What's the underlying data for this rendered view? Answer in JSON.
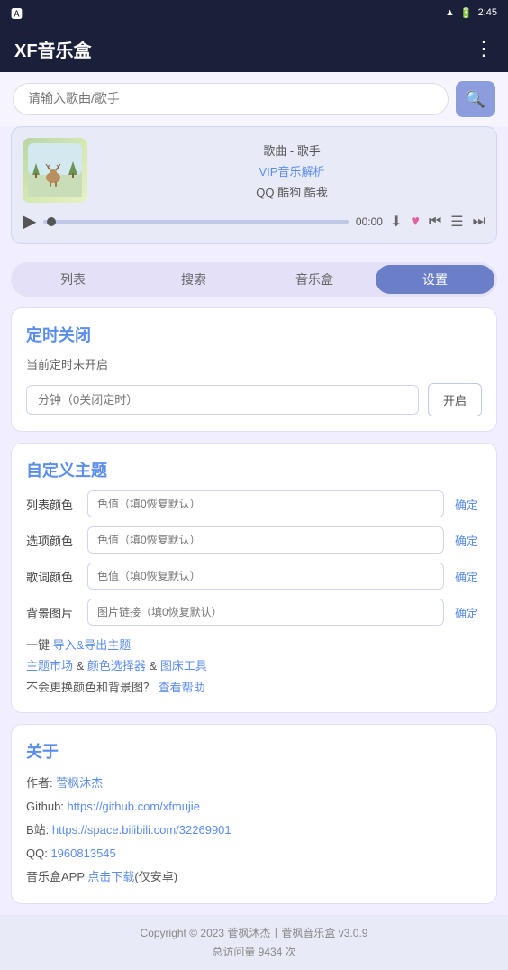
{
  "statusBar": {
    "app": "A",
    "time": "2:45",
    "wifiIcon": "wifi",
    "batteryIcon": "battery"
  },
  "topBar": {
    "title": "XF音乐盒",
    "moreIcon": "⋮"
  },
  "search": {
    "placeholder": "请输入歌曲/歌手",
    "searchIcon": "🔍"
  },
  "player": {
    "songTitle": "歌曲 - 歌手",
    "vipLabel": "VIP音乐解析",
    "platforms": "QQ 酷狗 酷我",
    "time": "00:00",
    "playIcon": "▶",
    "downloadIcon": "⬇",
    "heartIcon": "♥",
    "prevIcon": "⏮",
    "listIcon": "☰",
    "nextIcon": "⏭"
  },
  "tabs": [
    {
      "id": "list",
      "label": "列表"
    },
    {
      "id": "search",
      "label": "搜索"
    },
    {
      "id": "musicbox",
      "label": "音乐盒"
    },
    {
      "id": "settings",
      "label": "设置",
      "active": true
    }
  ],
  "timerSection": {
    "title": "定时关闭",
    "status": "当前定时未开启",
    "inputPlaceholder": "分钟（0关闭定时）",
    "btnLabel": "开启"
  },
  "themeSection": {
    "title": "自定义主题",
    "rows": [
      {
        "label": "列表颜色",
        "placeholder": "色值（填0恢复默认）",
        "btn": "确定"
      },
      {
        "label": "选项颜色",
        "placeholder": "色值（填0恢复默认）",
        "btn": "确定"
      },
      {
        "label": "歌词颜色",
        "placeholder": "色值（填0恢复默认）",
        "btn": "确定"
      },
      {
        "label": "背景图片",
        "placeholder": "图片链接（填0恢复默认）",
        "btn": "确定"
      }
    ],
    "exportLine": "一键 导入&导出主题",
    "marketLine": "主题市场 & 颜色选择器 & 图床工具",
    "helpLine": "不会更换颜色和背景图？ 查看帮助"
  },
  "aboutSection": {
    "title": "关于",
    "author": "作者: 菅枫沐杰",
    "github": "Github: https://github.com/xfmujie",
    "bilibili": "B站: https://space.bilibili.com/32269901",
    "qq": "QQ: 1960813545",
    "appLine": "音乐盒APP 点击下载(仅安卓)"
  },
  "footer": {
    "copyright": "Copyright © 2023 菅枫沐杰丨菅枫音乐盒 v3.0.9",
    "visits": "总访问量 9434 次"
  }
}
